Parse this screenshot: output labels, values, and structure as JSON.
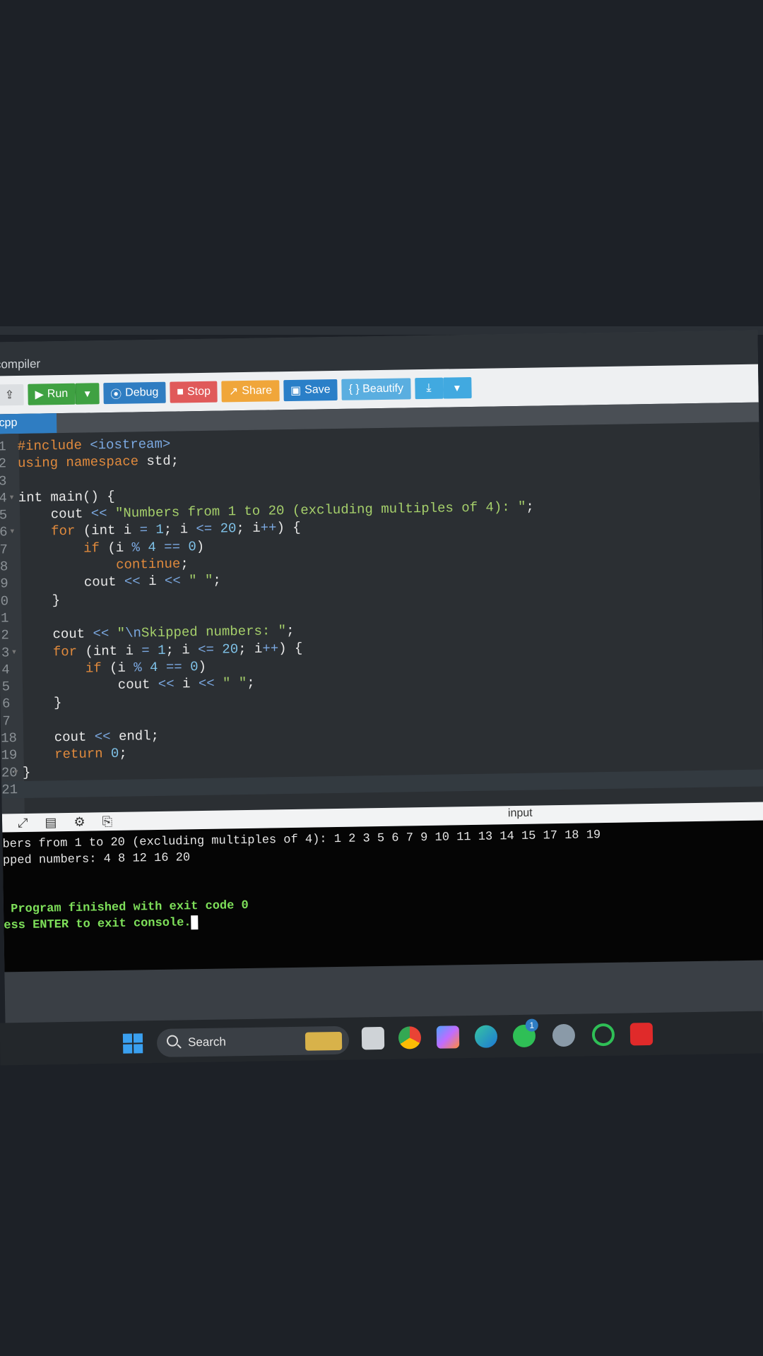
{
  "window": {
    "title": "compiler"
  },
  "toolbar": {
    "run_label": "Run",
    "debug_label": "Debug",
    "stop_label": "Stop",
    "share_label": "Share",
    "save_label": "Save",
    "beautify_label": "{ } Beautify"
  },
  "tab": {
    "filename": ".cpp"
  },
  "editor": {
    "lines": [
      {
        "n": "1",
        "fold": ""
      },
      {
        "n": "2",
        "fold": ""
      },
      {
        "n": "3",
        "fold": ""
      },
      {
        "n": "4",
        "fold": "▾"
      },
      {
        "n": "5",
        "fold": ""
      },
      {
        "n": "6",
        "fold": "▾"
      },
      {
        "n": "7",
        "fold": ""
      },
      {
        "n": "8",
        "fold": ""
      },
      {
        "n": "9",
        "fold": ""
      },
      {
        "n": "0",
        "fold": ""
      },
      {
        "n": "1",
        "fold": ""
      },
      {
        "n": "2",
        "fold": ""
      },
      {
        "n": "3",
        "fold": "▾"
      },
      {
        "n": "4",
        "fold": ""
      },
      {
        "n": "5",
        "fold": ""
      },
      {
        "n": "6",
        "fold": ""
      },
      {
        "n": "7",
        "fold": ""
      },
      {
        "n": "18",
        "fold": ""
      },
      {
        "n": "19",
        "fold": ""
      },
      {
        "n": "20",
        "fold": "▾"
      },
      {
        "n": "21",
        "fold": ""
      }
    ]
  },
  "console": {
    "input_label": "input",
    "line1": "bers from 1 to 20 (excluding multiples of 4): 1 2 3 5 6 7 9 10 11 13 14 15 17 18 19",
    "line2": "pped numbers: 4 8 12 16 20",
    "line3": " Program finished with exit code 0",
    "line4": "ess ENTER to exit console."
  },
  "taskbar": {
    "search_label": "Search",
    "whatsapp_badge": "1"
  },
  "colors": {
    "accent_blue": "#2f7dc2",
    "run_green": "#3fa142",
    "stop_red": "#e05a5a",
    "share_orange": "#f0a63a",
    "keyword": "#e08a3d",
    "string": "#a6d06b",
    "console_green": "#7ee05a"
  }
}
